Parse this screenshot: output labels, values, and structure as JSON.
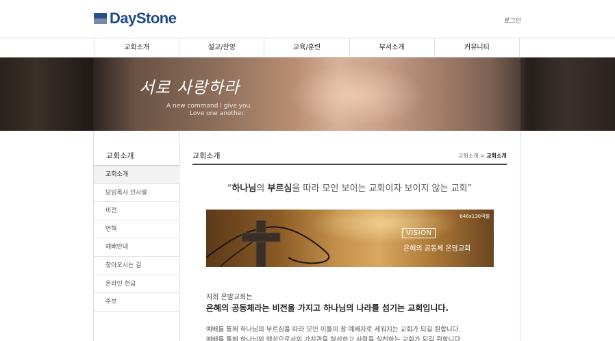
{
  "header": {
    "logo_text": "DayStone",
    "login_label": "로그인"
  },
  "gnb": {
    "items": [
      "교회소개",
      "설교/찬양",
      "교육/훈련",
      "부서소개",
      "커뮤니티"
    ]
  },
  "banner": {
    "script_title": "서로 사랑하라",
    "subtitle_line1": "A new command I give you.",
    "subtitle_line2": "Love one another."
  },
  "sidebar": {
    "title": "교회소개",
    "items": [
      {
        "label": "교회소개",
        "active": true
      },
      {
        "label": "담임목사 인사말",
        "active": false
      },
      {
        "label": "비전",
        "active": false
      },
      {
        "label": "연혁",
        "active": false
      },
      {
        "label": "예배안내",
        "active": false
      },
      {
        "label": "찾아오시는 길",
        "active": false
      },
      {
        "label": "온라인 헌금",
        "active": false
      },
      {
        "label": "주보",
        "active": false
      }
    ]
  },
  "content": {
    "page_title": "교회소개",
    "breadcrumb": {
      "parent": "교회소개",
      "separator": ">",
      "current": "교회소개"
    },
    "quote": {
      "open": "“",
      "part1": "하나님",
      "part2": "의 ",
      "part3": "부르심",
      "part4": "을 따라 모인 보이는 교회이자 보이지 않는 교회",
      "close": "”"
    },
    "vision_banner": {
      "size_label": "646x130픽셀",
      "box_label": "VISION",
      "caption": "은혜의 공동체 온맘교회"
    },
    "intro_small": "저희 온맘교회는",
    "intro_big": "은혜의 공동체라는 비전을 가지고 하나님의 나라를 섬기는 교회입니다.",
    "body_lines": [
      "예배를 통해 하나님의 부르심을 따라 모인 이들이 참 예배자로 세워지는 교회가 되길 원합니다.",
      "예배를 통해 하나님의 백성으로서의 가치관을 형성하고 사랑을 실천하는 교회가 되길 원합니다."
    ]
  },
  "colors": {
    "brand": "#1d4a8c",
    "title_rule": "#444444",
    "active_menu_bg": "#f2f2f2"
  }
}
